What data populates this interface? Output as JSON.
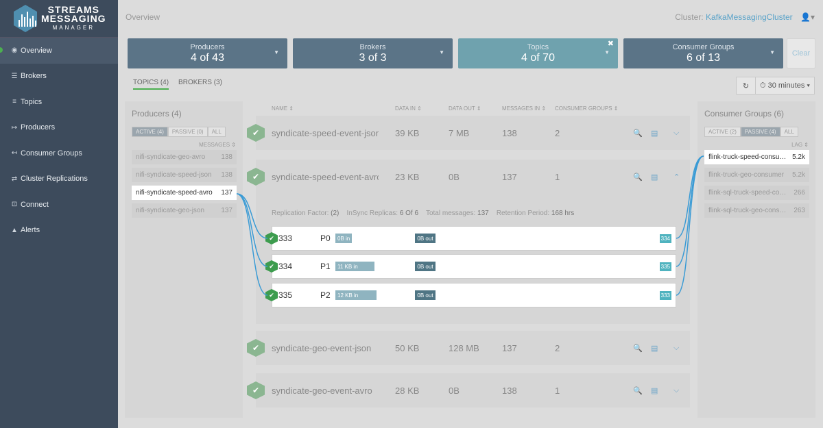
{
  "logo": {
    "line1": "STREAMS",
    "line2": "MESSAGING",
    "line3": "MANAGER"
  },
  "nav": [
    {
      "label": "Overview",
      "icon": "dashboard-icon",
      "glyph": "◉"
    },
    {
      "label": "Brokers",
      "icon": "brokers-icon",
      "glyph": "☰"
    },
    {
      "label": "Topics",
      "icon": "database-icon",
      "glyph": "≡"
    },
    {
      "label": "Producers",
      "icon": "sign-out-icon",
      "glyph": "↦"
    },
    {
      "label": "Consumer Groups",
      "icon": "sign-in-icon",
      "glyph": "↤"
    },
    {
      "label": "Cluster Replications",
      "icon": "exchange-icon",
      "glyph": "⇄"
    },
    {
      "label": "Connect",
      "icon": "connect-icon",
      "glyph": "⊡"
    },
    {
      "label": "Alerts",
      "icon": "warning-icon",
      "glyph": "▲"
    }
  ],
  "header": {
    "title": "Overview",
    "cluster_label": "Cluster:",
    "cluster_name": "KafkaMessagingCluster",
    "user_glyph": "👤▾"
  },
  "cards": [
    {
      "label": "Producers",
      "value": "4 of 43"
    },
    {
      "label": "Brokers",
      "value": "3 of 3"
    },
    {
      "label": "Topics",
      "value": "4 of 70"
    },
    {
      "label": "Consumer Groups",
      "value": "6 of 13"
    }
  ],
  "clear_label": "Clear",
  "subtabs": {
    "topics": "TOPICS (4)",
    "brokers": "BROKERS (3)"
  },
  "time": {
    "refresh_glyph": "↻",
    "range": "⏱ 30 minutes ▾"
  },
  "producers": {
    "title": "Producers (4)",
    "toggles": [
      "ACTIVE (4)",
      "PASSIVE (0)",
      "ALL"
    ],
    "col": "MESSAGES ⇕",
    "items": [
      {
        "name": "nifi-syndicate-geo-avro",
        "count": "138"
      },
      {
        "name": "nifi-syndicate-speed-json",
        "count": "138"
      },
      {
        "name": "nifi-syndicate-speed-avro",
        "count": "137"
      },
      {
        "name": "nifi-syndicate-geo-json",
        "count": "137"
      }
    ]
  },
  "consumers": {
    "title": "Consumer Groups (6)",
    "toggles": [
      "ACTIVE (2)",
      "PASSIVE (4)",
      "ALL"
    ],
    "col": "LAG ⇕",
    "items": [
      {
        "name": "flink-truck-speed-consumer",
        "count": "5.2k"
      },
      {
        "name": "flink-truck-geo-consumer",
        "count": "5.2k"
      },
      {
        "name": "flink-sql-truck-speed-consumer",
        "count": "266"
      },
      {
        "name": "flink-sql-truck-geo-consumer",
        "count": "263"
      }
    ]
  },
  "table": {
    "cols": [
      "NAME ⇕",
      "DATA IN ⇕",
      "DATA OUT ⇕",
      "MESSAGES IN ⇕",
      "CONSUMER GROUPS ⇕"
    ],
    "rows": [
      {
        "name": "syndicate-speed-event-json",
        "data_in": "39 KB",
        "data_out": "7 MB",
        "messages": "138",
        "groups": "2",
        "chevron": "⌵"
      },
      {
        "name": "syndicate-speed-event-avro",
        "data_in": "23 KB",
        "data_out": "0B",
        "messages": "137",
        "groups": "1",
        "chevron": "⌃"
      },
      {
        "name": "syndicate-geo-event-json",
        "data_in": "50 KB",
        "data_out": "128 MB",
        "messages": "137",
        "groups": "2",
        "chevron": "⌵"
      },
      {
        "name": "syndicate-geo-event-avro",
        "data_in": "28 KB",
        "data_out": "0B",
        "messages": "138",
        "groups": "1",
        "chevron": "⌵"
      }
    ]
  },
  "details": {
    "replication_label": "Replication Factor:",
    "replication": "(2)",
    "insync_label": "InSync Replicas:",
    "insync": "6 Of 6",
    "total_label": "Total messages:",
    "total": "137",
    "retention_label": "Retention Period:",
    "retention": "168 hrs"
  },
  "partitions": [
    {
      "broker": "333",
      "name": "P0",
      "in": "0B in",
      "out": "0B out",
      "replica": "334",
      "in_fraction": 0.0
    },
    {
      "broker": "334",
      "name": "P1",
      "in": "11 KB in",
      "out": "0B out",
      "replica": "335",
      "in_fraction": 0.92
    },
    {
      "broker": "335",
      "name": "P2",
      "in": "12 KB in",
      "out": "0B out",
      "replica": "333",
      "in_fraction": 1.0
    }
  ],
  "colors": {
    "accent": "#4caf50",
    "link": "#3a9bd5",
    "card": "#5b7487",
    "card_selected": "#6fa2ae"
  }
}
